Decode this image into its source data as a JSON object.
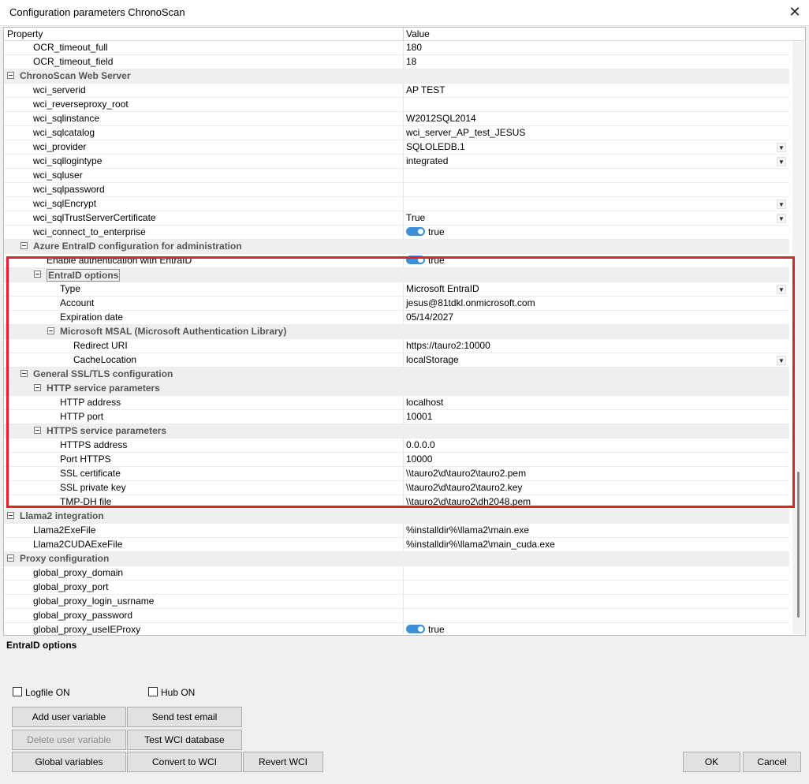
{
  "window": {
    "title": "Configuration parameters ChronoScan",
    "close_glyph": "✕"
  },
  "grid": {
    "col_property": "Property",
    "col_value": "Value",
    "rows": [
      {
        "label": "OCR_timeout_full",
        "value": "180",
        "indent": 1
      },
      {
        "label": "OCR_timeout_field",
        "value": "18",
        "indent": 1
      },
      {
        "label": "ChronoScan Web Server",
        "cat": true,
        "indent": 0
      },
      {
        "label": "wci_serverid",
        "value": "AP TEST",
        "indent": 1
      },
      {
        "label": "wci_reverseproxy_root",
        "value": "",
        "indent": 1
      },
      {
        "label": "wci_sqlinstance",
        "value": "W2012SQL2014",
        "indent": 1
      },
      {
        "label": "wci_sqlcatalog",
        "value": "wci_server_AP_test_JESUS",
        "indent": 1
      },
      {
        "label": "wci_provider",
        "value": "SQLOLEDB.1",
        "dd": true,
        "indent": 1
      },
      {
        "label": "wci_sqllogintype",
        "value": "integrated",
        "dd": true,
        "indent": 1
      },
      {
        "label": "wci_sqluser",
        "value": "",
        "indent": 1
      },
      {
        "label": "wci_sqlpassword",
        "value": "",
        "indent": 1
      },
      {
        "label": "wci_sqlEncrypt",
        "value": "",
        "dd": true,
        "indent": 1
      },
      {
        "label": "wci_sqlTrustServerCertificate",
        "value": "True",
        "dd": true,
        "indent": 1
      },
      {
        "label": "wci_connect_to_enterprise",
        "value": "true",
        "toggle": true,
        "indent": 1
      },
      {
        "label": "Azure EntraID configuration for administration",
        "cat": true,
        "indent": 1
      },
      {
        "label": "Enable authentication with EntraID",
        "value": "true",
        "toggle": true,
        "indent": 2
      },
      {
        "label": "EntraID options",
        "cat": true,
        "focused": true,
        "indent": 2
      },
      {
        "label": "Type",
        "value": "Microsoft EntraID",
        "dd": true,
        "indent": 3
      },
      {
        "label": "Account",
        "value": "jesus@81tdkl.onmicrosoft.com",
        "indent": 3
      },
      {
        "label": "Expiration date",
        "value": "05/14/2027",
        "indent": 3
      },
      {
        "label": "Microsoft MSAL (Microsoft Authentication Library)",
        "cat": true,
        "indent": 3
      },
      {
        "label": "Redirect URI",
        "value": "https://tauro2:10000",
        "indent": 4
      },
      {
        "label": "CacheLocation",
        "value": "localStorage",
        "dd": true,
        "indent": 4
      },
      {
        "label": "General SSL/TLS configuration",
        "cat": true,
        "indent": 1
      },
      {
        "label": "HTTP service parameters",
        "cat": true,
        "indent": 2
      },
      {
        "label": "HTTP address",
        "value": "localhost",
        "indent": 3
      },
      {
        "label": "HTTP port",
        "value": "10001",
        "indent": 3
      },
      {
        "label": "HTTPS service parameters",
        "cat": true,
        "indent": 2
      },
      {
        "label": "HTTPS address",
        "value": "0.0.0.0",
        "indent": 3
      },
      {
        "label": "Port HTTPS",
        "value": "10000",
        "indent": 3
      },
      {
        "label": "SSL certificate",
        "value": "\\\\tauro2\\d\\tauro2\\tauro2.pem",
        "indent": 3
      },
      {
        "label": "SSL private key",
        "value": "\\\\tauro2\\d\\tauro2\\tauro2.key",
        "indent": 3
      },
      {
        "label": "TMP-DH file",
        "value": "\\\\tauro2\\d\\tauro2\\dh2048.pem",
        "indent": 3
      },
      {
        "label": "Llama2 integration",
        "cat": true,
        "indent": 0
      },
      {
        "label": "Llama2ExeFile",
        "value": "%installdir%\\llama2\\main.exe",
        "indent": 1
      },
      {
        "label": "Llama2CUDAExeFile",
        "value": "%installdir%\\llama2\\main_cuda.exe",
        "indent": 1
      },
      {
        "label": "Proxy configuration",
        "cat": true,
        "indent": 0
      },
      {
        "label": "global_proxy_domain",
        "value": "",
        "indent": 1
      },
      {
        "label": "global_proxy_port",
        "value": "",
        "indent": 1
      },
      {
        "label": "global_proxy_login_usrname",
        "value": "",
        "indent": 1
      },
      {
        "label": "global_proxy_password",
        "value": "",
        "indent": 1
      },
      {
        "label": "global_proxy_useIEProxy",
        "value": "true",
        "toggle": true,
        "indent": 1
      }
    ]
  },
  "description": "EntraID options",
  "checkboxes": {
    "logfile": "Logfile ON",
    "hub": "Hub ON"
  },
  "buttons": {
    "add_user_variable": "Add user variable",
    "send_test_email": "Send test email",
    "delete_user_variable": "Delete user variable",
    "test_wci_database": "Test WCI database",
    "global_variables": "Global variables",
    "convert_to_wci": "Convert to WCI",
    "revert_wci": "Revert WCI",
    "ok": "OK",
    "cancel": "Cancel"
  },
  "colors": {
    "highlight": "#e0202a",
    "toggle_on": "#3d8fd8",
    "window_bg": "#f0f0f0"
  }
}
